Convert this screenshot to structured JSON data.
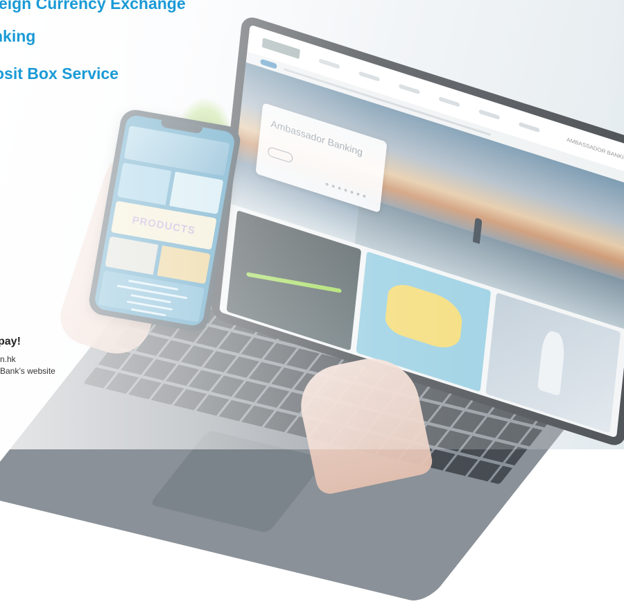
{
  "headings": {
    "foreign_currency": "reign Currency Exchange",
    "banking": "nking",
    "safe_deposit": "osit Box Service",
    "pay": "pay!"
  },
  "footer_text": {
    "line1": "n.hk",
    "line2": "Bank’s website"
  },
  "laptop": {
    "hero_title": "Ambassador Banking",
    "nav_brand": "AMBASSADOR BANKING"
  },
  "phone": {
    "products_label": "PRODUCTS"
  },
  "colors": {
    "heading": "#1a9ad6",
    "phone_screen": "#3b8fb8"
  }
}
